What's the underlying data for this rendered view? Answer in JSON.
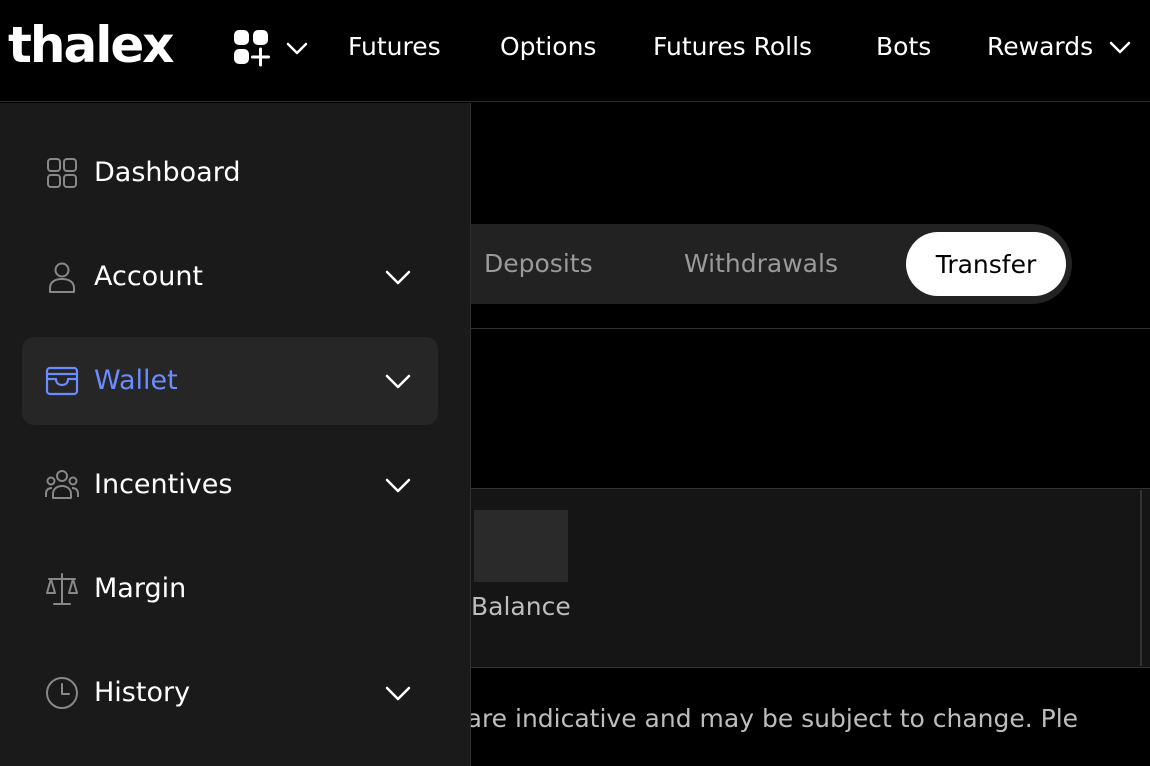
{
  "header": {
    "logo": "thalex",
    "nav": [
      "Futures",
      "Options",
      "Futures Rolls",
      "Bots",
      "Rewards"
    ]
  },
  "tabs": {
    "items": [
      "Deposits",
      "Withdrawals"
    ],
    "active": "Transfer"
  },
  "card": {
    "label": "Balance"
  },
  "disclaimer": "ers are indicative and may be subject to change. Ple",
  "sidebar": {
    "items": [
      {
        "label": "Dashboard",
        "icon": "dashboard-grid-icon"
      },
      {
        "label": "Account",
        "icon": "user-icon"
      },
      {
        "label": "Wallet",
        "icon": "wallet-icon"
      },
      {
        "label": "Incentives",
        "icon": "group-icon"
      },
      {
        "label": "Margin",
        "icon": "scale-icon"
      },
      {
        "label": "History",
        "icon": "clock-icon"
      }
    ],
    "active": "Wallet"
  },
  "colors": {
    "accent": "#6b8cff",
    "background": "#000000",
    "sidebar": "#1a1a1a"
  }
}
